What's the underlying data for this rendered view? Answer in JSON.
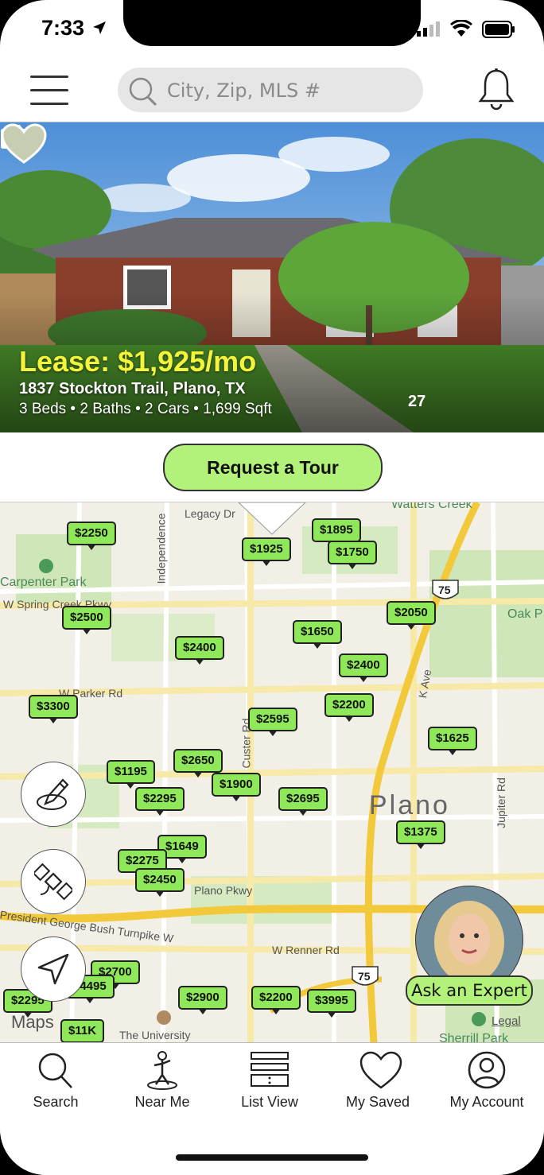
{
  "status_bar": {
    "time": "7:33"
  },
  "header": {
    "search_placeholder": "City, Zip, MLS #"
  },
  "listing": {
    "price": "Lease: $1,925/mo",
    "address": "1837 Stockton Trail, Plano, TX",
    "specs": "3 Beds • 2 Baths • 2 Cars • 1,699 Sqft",
    "photo_count": "27"
  },
  "tour_button": "Request a Tour",
  "map": {
    "labels": {
      "legacy": "Legacy Dr",
      "watters": "Watters Creek",
      "independence": "Independence",
      "carpenter": "Carpenter Park",
      "spring_creek": "W Spring Creek Pkwy",
      "parker": "W Parker Rd",
      "custer": "Custer Rd",
      "k_ave": "K Ave",
      "oak_park": "Oak P",
      "plano": "Plano",
      "jupiter": "Jupiter Rd",
      "plano_pkwy": "Plano Pkwy",
      "bush": "President George Bush Turnpike W",
      "renner": "W Renner Rd",
      "university": "The University",
      "sherrill": "Sherrill Park",
      "hwy75": "75",
      "maps": "Maps",
      "legal": "Legal"
    },
    "pins": [
      "$2250",
      "$1925",
      "$1895",
      "$1750",
      "$2500",
      "$2050",
      "$1650",
      "$2400",
      "$2400",
      "$3300",
      "$2200",
      "$2595",
      "$1625",
      "$1195",
      "$2650",
      "$1900",
      "$2295",
      "$2695",
      "$1375",
      "$1649",
      "$2275",
      "$2450",
      "$2700",
      "$4495",
      "$2900",
      "$2200",
      "$3995",
      "$11K",
      "$2295"
    ],
    "expert_button": "Ask an Expert"
  },
  "tabs": [
    {
      "label": "Search",
      "icon": "search-icon"
    },
    {
      "label": "Near Me",
      "icon": "person-location-icon"
    },
    {
      "label": "List View",
      "icon": "list-icon"
    },
    {
      "label": "My Saved",
      "icon": "heart-icon"
    },
    {
      "label": "My Account",
      "icon": "account-icon"
    }
  ],
  "colors": {
    "accent": "#b3f27a",
    "pin": "#8fe85a",
    "price": "#f4f43a"
  }
}
